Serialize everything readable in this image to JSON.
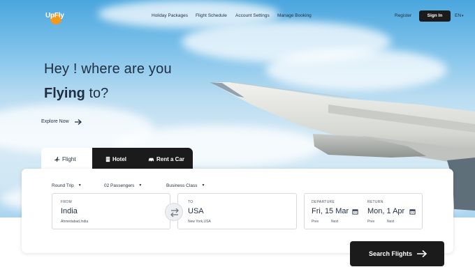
{
  "header": {
    "logo_text": "UpFly",
    "nav": [
      "Holiday Packages",
      "Flight Schedule",
      "Account Settings",
      "Manage Booking"
    ],
    "register_label": "Register",
    "signin_label": "Sign In",
    "language": "EN"
  },
  "hero": {
    "headline_line1": "Hey ! where are you",
    "headline_bold": "Flying",
    "headline_rest": "to?",
    "explore_label": "Explore Now"
  },
  "tabs": [
    {
      "label": "Flight",
      "icon": "plane-icon",
      "active": true
    },
    {
      "label": "Hotel",
      "icon": "building-icon",
      "active": false
    },
    {
      "label": "Rent a Car",
      "icon": "car-icon",
      "active": false
    }
  ],
  "search": {
    "trip_type": "Round Trip",
    "passengers": "02 Passengers",
    "class": "Business Class",
    "from": {
      "label": "FROM",
      "city": "India",
      "detail": "Ahmedabad,India"
    },
    "to": {
      "label": "TO",
      "city": "USA",
      "detail": "New York,USA"
    },
    "departure": {
      "label": "DEPARTURE",
      "date": "Fri, 15 Mar",
      "prev": "Prev",
      "next": "Next"
    },
    "return": {
      "label": "RETURN",
      "date": "Mon, 1 Apr",
      "prev": "Prev",
      "next": "Next"
    },
    "button_label": "Search Flights"
  },
  "colors": {
    "dark": "#1b1b1b",
    "text": "#1f2e40",
    "accent_logo": "#f39a1b",
    "sky": "#7cc1ea"
  }
}
